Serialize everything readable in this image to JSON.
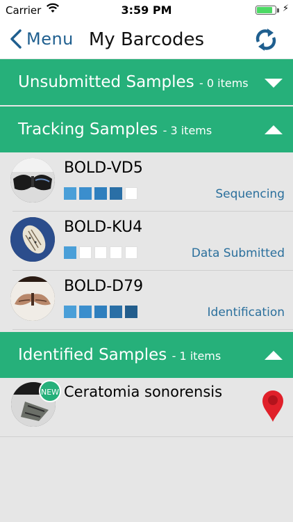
{
  "status_bar": {
    "carrier": "Carrier",
    "time": "3:59 PM",
    "battery_level": 0.85
  },
  "nav": {
    "back_label": "Menu",
    "title": "My Barcodes"
  },
  "sections": {
    "unsubmitted": {
      "title": "Unsubmitted Samples",
      "count": "- 0 items",
      "expanded": false
    },
    "tracking": {
      "title": "Tracking Samples",
      "count": "- 3 items",
      "expanded": true
    },
    "identified": {
      "title": "Identified Samples",
      "count": "- 1 items",
      "expanded": true
    }
  },
  "tracking_items": [
    {
      "name": "BOLD-VD5",
      "stage": "Sequencing",
      "progress_filled": 4,
      "progress_total": 5
    },
    {
      "name": "BOLD-KU4",
      "stage": "Data Submitted",
      "progress_filled": 1,
      "progress_total": 5
    },
    {
      "name": "BOLD-D79",
      "stage": "Identification",
      "progress_filled": 5,
      "progress_total": 5
    }
  ],
  "identified_items": [
    {
      "name": "Ceratomia sonorensis",
      "badge": "NEW"
    }
  ],
  "colors": {
    "accent_green": "#26b07a",
    "nav_blue": "#1f5f8f",
    "stage_text": "#2a6f9c",
    "progress": [
      "#4a9fd8",
      "#3b8ecd",
      "#2f7fbe",
      "#2a6fa6",
      "#225d8c"
    ],
    "pin_red": "#e0202a"
  }
}
